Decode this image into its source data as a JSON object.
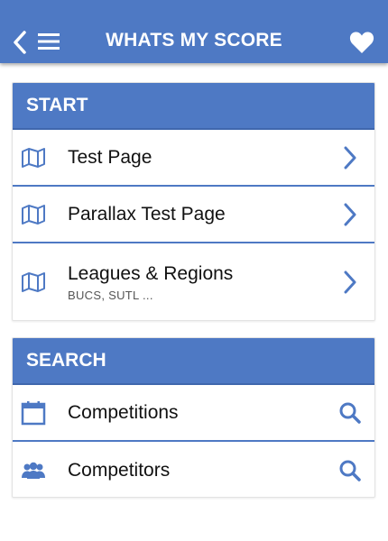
{
  "appbar": {
    "title": "WHATS MY SCORE",
    "icons": {
      "back": "chevron-left-icon",
      "menu": "hamburger-menu-icon",
      "favorite": "heart-icon"
    }
  },
  "colors": {
    "primary": "#4e79c4",
    "primary_dark": "#3f67ad",
    "text": "#111111",
    "subtext": "#555555"
  },
  "start_card": {
    "header": "START",
    "items": [
      {
        "label": "Test Page",
        "icon": "map-icon",
        "action_icon": "chevron-right-icon"
      },
      {
        "label": "Parallax Test Page",
        "icon": "map-icon",
        "action_icon": "chevron-right-icon"
      },
      {
        "label": "Leagues & Regions",
        "subtitle": "BUCS, SUTL ...",
        "icon": "map-icon",
        "action_icon": "chevron-right-icon"
      }
    ]
  },
  "search_card": {
    "header": "SEARCH",
    "items": [
      {
        "label": "Competitions",
        "icon": "calendar-icon",
        "action_icon": "search-icon"
      },
      {
        "label": "Competitors",
        "icon": "people-icon",
        "action_icon": "search-icon"
      }
    ]
  }
}
